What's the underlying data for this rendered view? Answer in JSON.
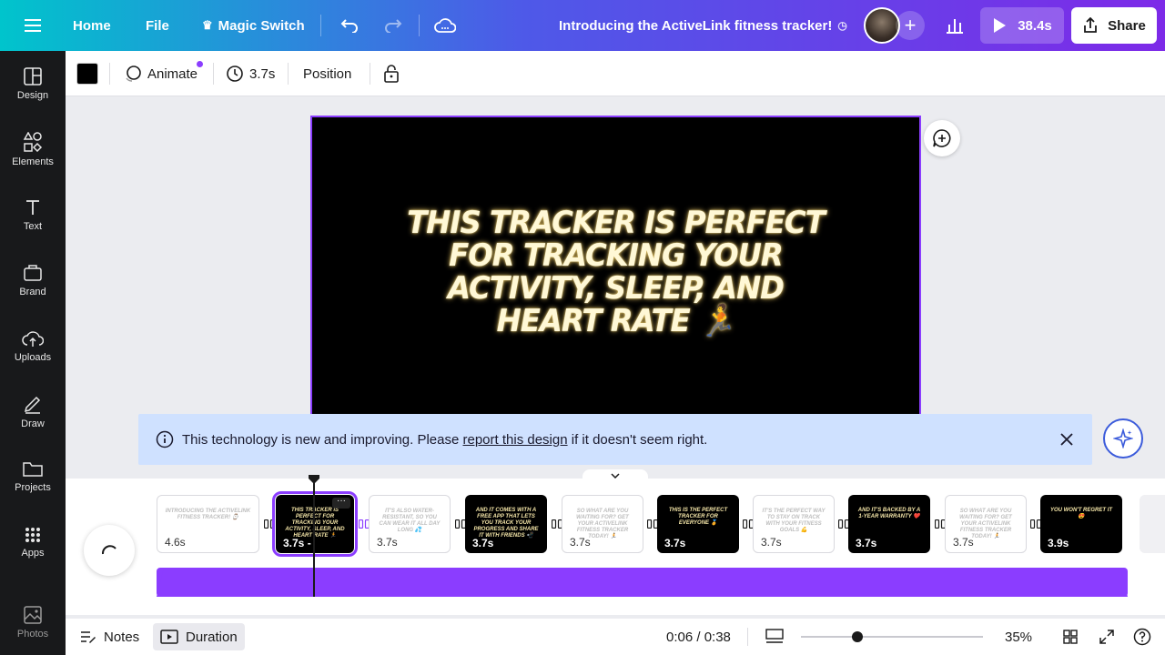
{
  "topbar": {
    "home": "Home",
    "file": "File",
    "magic_switch": "Magic Switch",
    "title": "Introducing the ActiveLink fitness tracker!",
    "play_label": "38.4s",
    "share": "Share"
  },
  "sidebar": {
    "items": [
      {
        "label": "Design",
        "icon": "design-icon"
      },
      {
        "label": "Elements",
        "icon": "elements-icon"
      },
      {
        "label": "Text",
        "icon": "text-icon"
      },
      {
        "label": "Brand",
        "icon": "brand-icon"
      },
      {
        "label": "Uploads",
        "icon": "uploads-icon"
      },
      {
        "label": "Draw",
        "icon": "draw-icon"
      },
      {
        "label": "Projects",
        "icon": "projects-icon"
      },
      {
        "label": "Apps",
        "icon": "apps-icon"
      },
      {
        "label": "Photos",
        "icon": "photos-icon"
      }
    ]
  },
  "toolbar": {
    "color": "#000000",
    "animate": "Animate",
    "duration": "3.7s",
    "position": "Position"
  },
  "slide": {
    "text": "THIS TRACKER IS PERFECT FOR TRACKING YOUR ACTIVITY, SLEEP, AND HEART RATE 🏃"
  },
  "notice": {
    "prefix": "This technology is new and improving. Please ",
    "link": "report this design",
    "suffix": " if it doesn't seem right."
  },
  "timeline": {
    "scenes": [
      {
        "text": "INTRODUCING THE ACTIVELINK FITNESS TRACKER! ⌚",
        "duration": "4.6s",
        "theme": "light"
      },
      {
        "text": "THIS TRACKER IS PERFECT FOR TRACKING YOUR ACTIVITY, SLEEP, AND HEART RATE 🏃",
        "duration": "3.7s -",
        "theme": "dark",
        "selected": true
      },
      {
        "text": "IT'S ALSO WATER-RESISTANT, SO YOU CAN WEAR IT ALL DAY LONG 💦",
        "duration": "3.7s",
        "theme": "light"
      },
      {
        "text": "AND IT COMES WITH A FREE APP THAT LETS YOU TRACK YOUR PROGRESS AND SHARE IT WITH FRIENDS 📲",
        "duration": "3.7s",
        "theme": "dark"
      },
      {
        "text": "SO WHAT ARE YOU WAITING FOR? GET YOUR ACTIVELINK FITNESS TRACKER TODAY! 🏃",
        "duration": "3.7s",
        "theme": "light"
      },
      {
        "text": "THIS IS THE PERFECT TRACKER FOR EVERYONE 🏅",
        "duration": "3.7s",
        "theme": "dark"
      },
      {
        "text": "IT'S THE PERFECT WAY TO STAY ON TRACK WITH YOUR FITNESS GOALS 💪",
        "duration": "3.7s",
        "theme": "light"
      },
      {
        "text": "AND IT'S BACKED BY A 1-YEAR WARRANTY ❤️",
        "duration": "3.7s",
        "theme": "dark"
      },
      {
        "text": "SO WHAT ARE YOU WAITING FOR? GET YOUR ACTIVELINK FITNESS TRACKER TODAY! 🏃",
        "duration": "3.7s",
        "theme": "light"
      },
      {
        "text": "YOU WON'T REGRET IT 😍",
        "duration": "3.9s",
        "theme": "dark"
      }
    ]
  },
  "bottombar": {
    "notes": "Notes",
    "duration": "Duration",
    "time": "0:06 / 0:38",
    "zoom": "35%",
    "zoom_level": 0.35
  }
}
